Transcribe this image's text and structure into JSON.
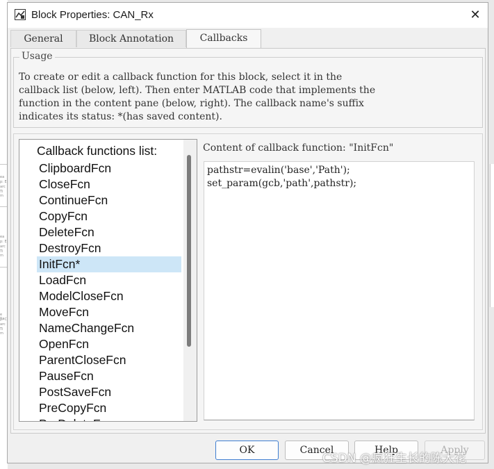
{
  "window": {
    "title": "Block Properties: CAN_Rx",
    "close_glyph": "✕"
  },
  "tabs": [
    {
      "label": "General"
    },
    {
      "label": "Block Annotation"
    },
    {
      "label": "Callbacks",
      "active": true
    }
  ],
  "usage": {
    "legend": "Usage",
    "lines": [
      "To create or edit a callback function for this block, select it in the",
      "callback list (below, left). Then enter MATLAB code that implements the",
      "function in the content pane (below, right). The callback name's suffix",
      "indicates its status: *(has saved content)."
    ]
  },
  "callbacks": {
    "list_title": "Callback functions list:",
    "items": [
      "ClipboardFcn",
      "CloseFcn",
      "ContinueFcn",
      "CopyFcn",
      "DeleteFcn",
      "DestroyFcn",
      "InitFcn*",
      "LoadFcn",
      "ModelCloseFcn",
      "MoveFcn",
      "NameChangeFcn",
      "OpenFcn",
      "ParentCloseFcn",
      "PauseFcn",
      "PostSaveFcn",
      "PreCopyFcn",
      "PreDeleteFcn"
    ],
    "selected_index": 6,
    "content_label": "Content of callback function: \"InitFcn\"",
    "code": [
      "pathstr=evalin('base','Path');",
      "set_param(gcb,'path',pathstr);"
    ]
  },
  "buttons": {
    "ok": "OK",
    "cancel": "Cancel",
    "help": "Help",
    "apply": "Apply"
  },
  "watermark": "CSDN @疯狂生长的陈大花",
  "background_fragments": [
    "ea",
    "p: E",
    "arc",
    "Ti m",
    "ea",
    "p: E",
    "arc",
    "Ti m",
    "e Ra",
    "p: C",
    "arc",
    "Ti m"
  ],
  "colors": {
    "selection": "#cde6f7",
    "primary_border": "#3f7ed1"
  }
}
